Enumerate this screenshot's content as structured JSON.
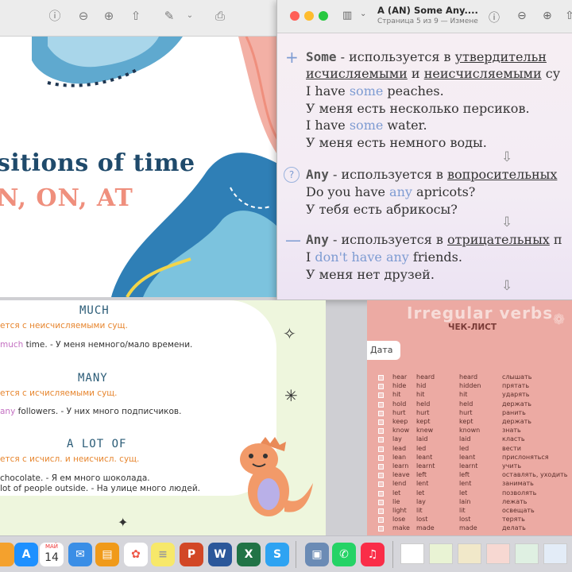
{
  "pdf_window": {
    "title": "A (AN) Some Any....",
    "subtitle": "Страница 5 из 9 — Измене",
    "lines": {
      "some_kw": "Some",
      "some_rule_a": " - используется в ",
      "some_rule_b": "утвердительн",
      "some_rule2_a": "исчисляемыми",
      "some_rule2_b": " и ",
      "some_rule2_c": "неисчисляемыми",
      "some_rule2_d": " су",
      "ex1_a": "I have ",
      "ex1_b": "some",
      "ex1_c": " peaches.",
      "ex1_ru": "У меня есть несколько персиков.",
      "ex2_a": "I have ",
      "ex2_b": "some",
      "ex2_c": " water.",
      "ex2_ru": "У меня есть немного воды.",
      "any_kw": "Any",
      "any_rule_a": " - используется в ",
      "any_rule_b": "вопросительных",
      "ex3_a": "Do you have ",
      "ex3_b": "any",
      "ex3_c": " apricots?",
      "ex3_ru": "У тебя есть абрикосы?",
      "any2_kw": "Any",
      "any2_rule_a": " - используется в ",
      "any2_rule_b": "отрицательных",
      "any2_rule_c": " п",
      "ex4_a": "I ",
      "ex4_b": "don't have any",
      "ex4_c": " friends.",
      "ex4_ru": "У меня нет друзей."
    }
  },
  "slide_window": {
    "title": "sitions of time",
    "subtitle": "N, ON, AT"
  },
  "much_window": {
    "much_head": "MUCH",
    "much_rule": "ется с неисчисляемыми сущ.",
    "much_ex_a": "much",
    "much_ex_b": " time. - У меня немного/мало времени.",
    "many_head": "MANY",
    "many_rule": "ется с исчисляемыми сущ.",
    "many_ex_a": "any",
    "many_ex_b": " followers.  - У них много подписчиков.",
    "alot_head": "A LOT OF",
    "alot_rule": "ется с исчисл. и неисчисл. сущ.",
    "alot_ex1": "chocolate. - Я ем много шоколада.",
    "alot_ex2": "lot of people outside. - На улице много людей."
  },
  "verbs_window": {
    "title": "Irregular verbs",
    "checklist": "ЧЕК-ЛИСТ",
    "date_label": "Дата",
    "rows": [
      [
        "hear",
        "heard",
        "heard",
        "слышать"
      ],
      [
        "hide",
        "hid",
        "hidden",
        "прятать"
      ],
      [
        "hit",
        "hit",
        "hit",
        "ударять"
      ],
      [
        "hold",
        "held",
        "held",
        "держать"
      ],
      [
        "hurt",
        "hurt",
        "hurt",
        "ранить"
      ],
      [
        "keep",
        "kept",
        "kept",
        "держать"
      ],
      [
        "know",
        "knew",
        "known",
        "знать"
      ],
      [
        "lay",
        "laid",
        "laid",
        "класть"
      ],
      [
        "lead",
        "led",
        "led",
        "вести"
      ],
      [
        "lean",
        "leant",
        "leant",
        "прислоняться"
      ],
      [
        "learn",
        "learnt",
        "learnt",
        "учить"
      ],
      [
        "leave",
        "left",
        "left",
        "оставлять, уходить"
      ],
      [
        "lend",
        "lent",
        "lent",
        "занимать"
      ],
      [
        "let",
        "let",
        "let",
        "позволять"
      ],
      [
        "lie",
        "lay",
        "lain",
        "лежать"
      ],
      [
        "light",
        "lit",
        "lit",
        "освещать"
      ],
      [
        "lose",
        "lost",
        "lost",
        "терять"
      ],
      [
        "make",
        "made",
        "made",
        "делать"
      ]
    ]
  },
  "dock": {
    "calendar_month": "МАЙ",
    "calendar_day": "14"
  }
}
